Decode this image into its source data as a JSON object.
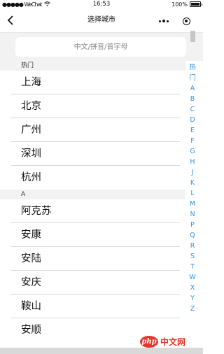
{
  "status_bar": {
    "carrier": "●●●●● WeChat",
    "wifi_icon": "wifi-icon",
    "time": "16:53",
    "battery_percent": "100%"
  },
  "nav": {
    "title": "选择城市",
    "back_icon": "chevron-left-icon",
    "more_icon": "more-dots-icon",
    "close_icon": "target-close-icon"
  },
  "search": {
    "placeholder": "中文/拼音/首字母",
    "value": ""
  },
  "sections": [
    {
      "header": "热门",
      "cities": [
        "上海",
        "北京",
        "广州",
        "深圳",
        "杭州"
      ]
    },
    {
      "header": "A",
      "cities": [
        "阿克苏",
        "安康",
        "安陆",
        "安庆",
        "鞍山",
        "安顺"
      ]
    }
  ],
  "index_letters": [
    "热",
    "门",
    "A",
    "B",
    "C",
    "D",
    "E",
    "F",
    "G",
    "H",
    "J",
    "K",
    "L",
    "M",
    "N",
    "P",
    "Q",
    "R",
    "S",
    "T",
    "W",
    "X",
    "Y",
    "Z"
  ],
  "watermark": {
    "logo_text": "php",
    "site_text": "中文网"
  },
  "colors": {
    "index_blue": "#2f95e8",
    "section_bg": "#f2f2f2",
    "divider": "#d8d8d8",
    "watermark_red": "#e2392c"
  }
}
